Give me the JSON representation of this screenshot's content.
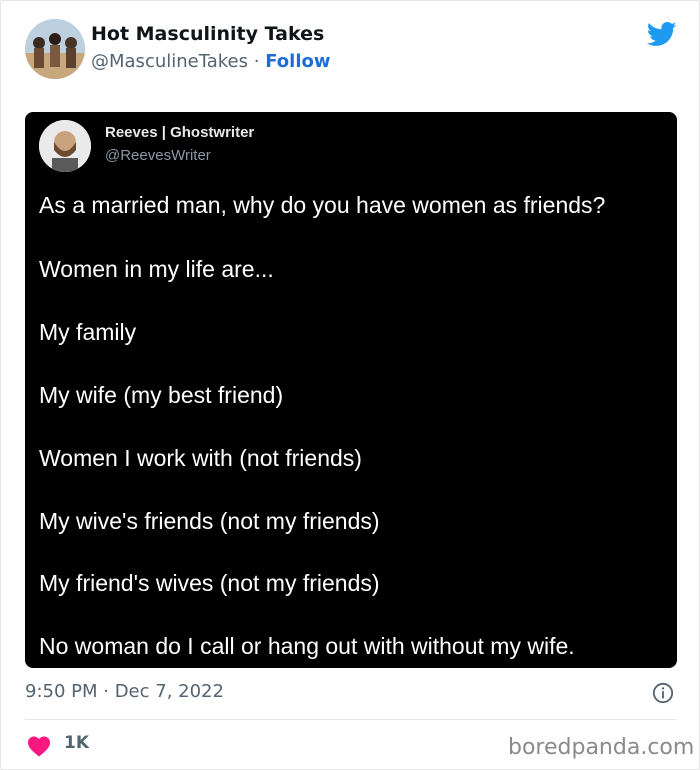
{
  "author": {
    "name": "Hot Masculinity Takes",
    "handle": "@MasculineTakes",
    "separator": "·",
    "follow_label": "Follow"
  },
  "embedded_tweet": {
    "name": "Reeves | Ghostwriter",
    "handle": "@ReevesWriter",
    "lines": [
      "As a married man, why do you have women as friends?",
      "Women in my life are...",
      "My family",
      "My wife (my best friend)",
      "Women I work with (not friends)",
      "My wive's friends (not my friends)",
      "My friend's wives (not my friends)",
      "No woman do I call or hang out with without my wife."
    ]
  },
  "meta": {
    "timestamp": "9:50 PM · Dec 7, 2022",
    "likes": "1K"
  },
  "watermark": "boredpanda.com",
  "colors": {
    "link": "#1d6fd8",
    "twitter_blue": "#1d9bf0",
    "heart": "#f91880",
    "muted": "#536471"
  },
  "icons": {
    "brand": "twitter-bird-icon",
    "info": "info-icon",
    "like": "heart-icon"
  }
}
